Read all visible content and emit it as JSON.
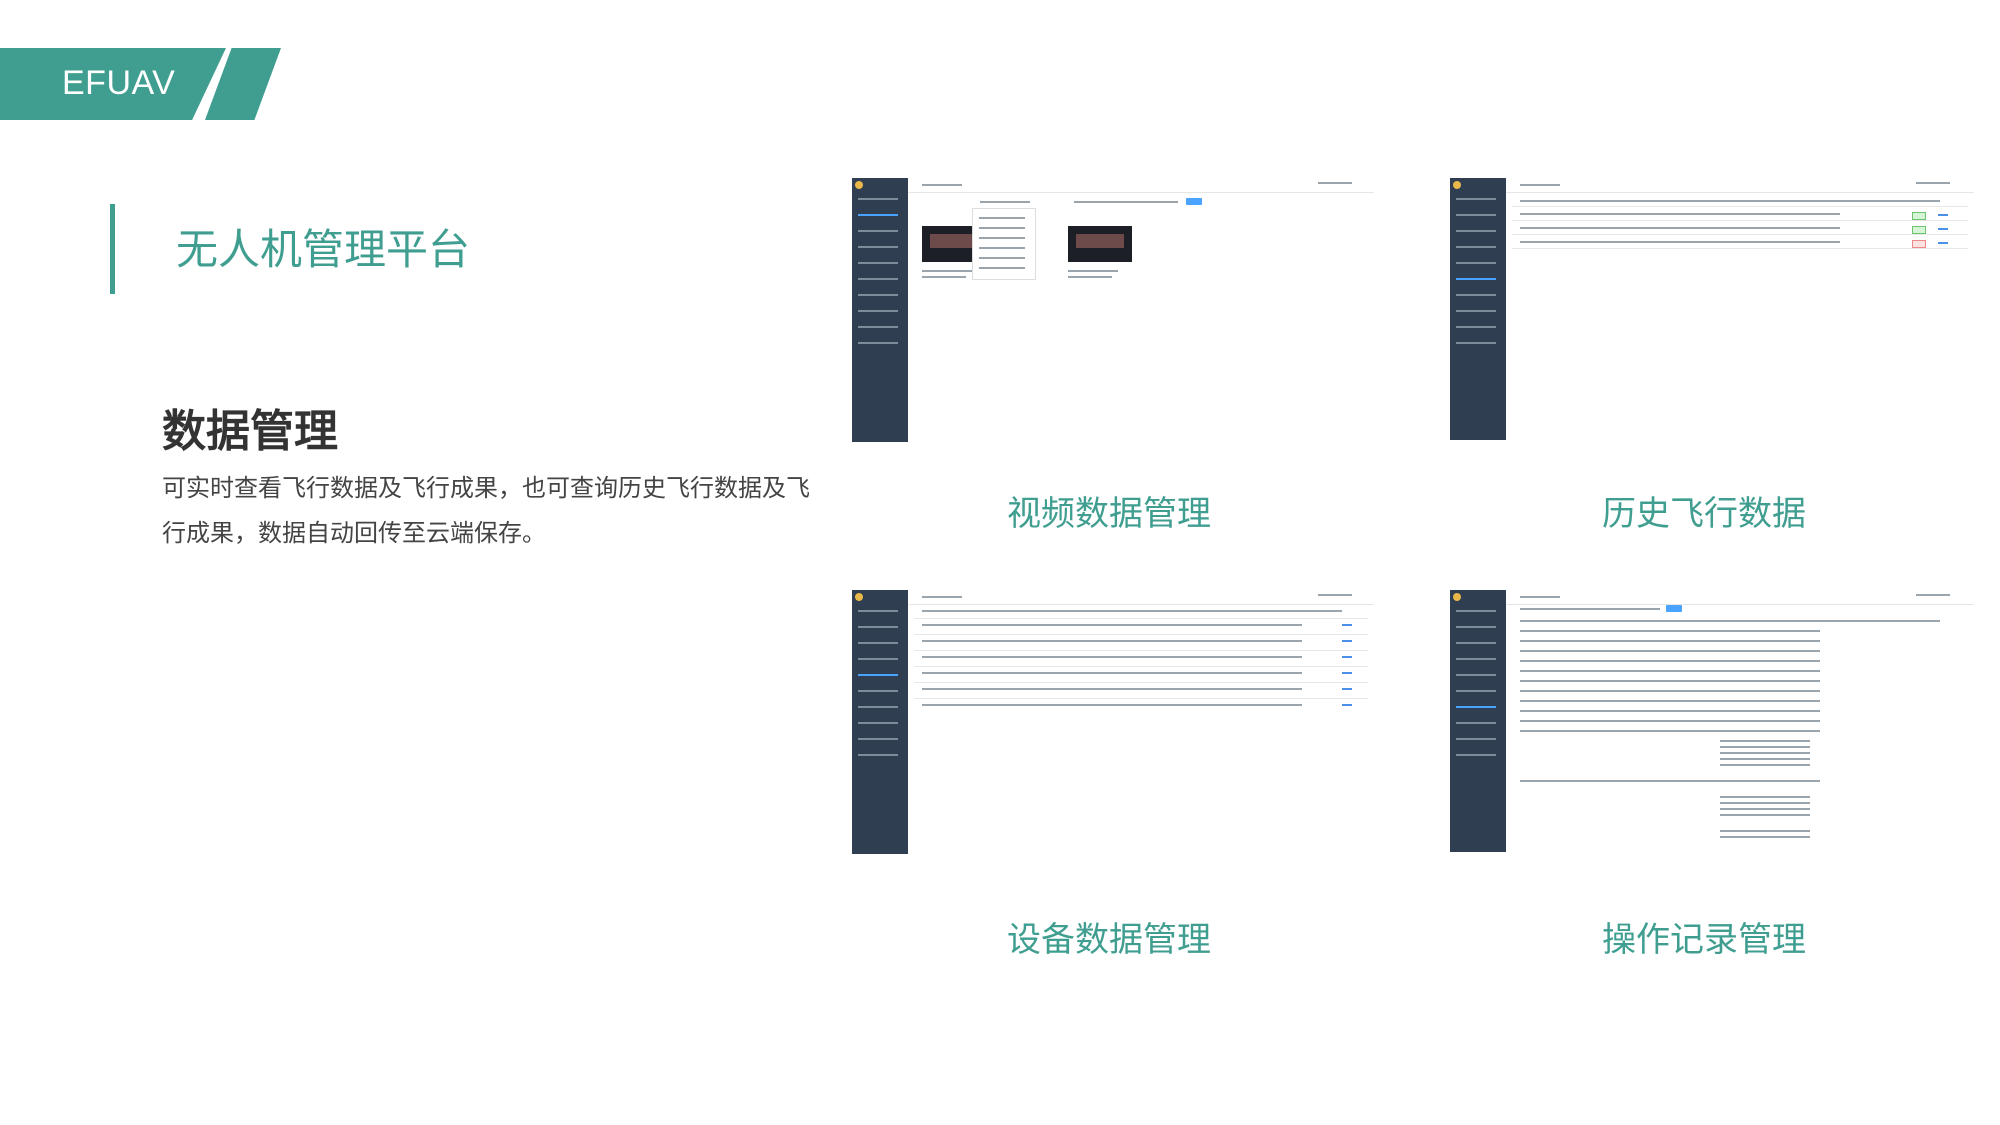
{
  "brand": {
    "name": "EFUAV",
    "color": "#3f9e90"
  },
  "page_title": "无人机管理平台",
  "section": {
    "heading": "数据管理",
    "description": "可实时查看飞行数据及飞行成果，也可查询历史飞行数据及飞行成果，数据自动回传至云端保存。"
  },
  "panels": [
    {
      "caption": "视频数据管理"
    },
    {
      "caption": "历史飞行数据"
    },
    {
      "caption": "设备数据管理"
    },
    {
      "caption": "操作记录管理"
    }
  ]
}
